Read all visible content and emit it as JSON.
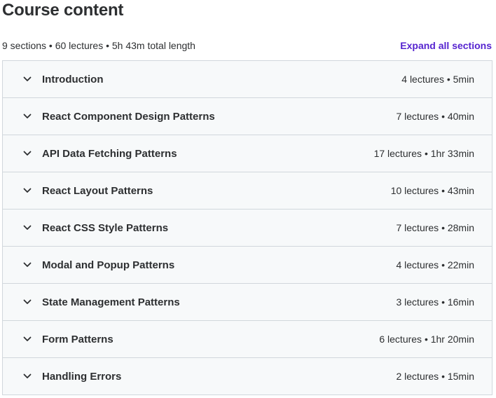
{
  "header": {
    "title": "Course content",
    "summary": "9 sections • 60 lectures • 5h 43m total length",
    "expand_label": "Expand all sections"
  },
  "colors": {
    "accent": "#5624d0",
    "section_bg": "#f7f9fa",
    "border": "#d1d7dc",
    "text": "#2d2f31"
  },
  "sections": [
    {
      "title": "Introduction",
      "meta": "4 lectures • 5min",
      "icon": "chevron-down-icon"
    },
    {
      "title": "React Component Design Patterns",
      "meta": "7 lectures • 40min",
      "icon": "chevron-down-icon"
    },
    {
      "title": "API Data Fetching Patterns",
      "meta": "17 lectures • 1hr 33min",
      "icon": "chevron-down-icon"
    },
    {
      "title": "React Layout Patterns",
      "meta": "10 lectures • 43min",
      "icon": "chevron-down-icon"
    },
    {
      "title": "React CSS Style Patterns",
      "meta": "7 lectures • 28min",
      "icon": "chevron-down-icon"
    },
    {
      "title": "Modal and Popup Patterns",
      "meta": "4 lectures • 22min",
      "icon": "chevron-down-icon"
    },
    {
      "title": "State Management Patterns",
      "meta": "3 lectures • 16min",
      "icon": "chevron-down-icon"
    },
    {
      "title": "Form Patterns",
      "meta": "6 lectures • 1hr 20min",
      "icon": "chevron-down-icon"
    },
    {
      "title": "Handling Errors",
      "meta": "2 lectures • 15min",
      "icon": "chevron-down-icon"
    }
  ]
}
